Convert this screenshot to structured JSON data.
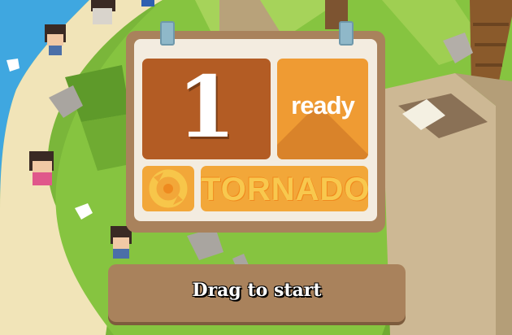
{
  "title_card": {
    "count": "1",
    "status": "ready",
    "power_up": "TORNADO",
    "power_up_icon": "tornado-icon"
  },
  "start_button": {
    "label": "Drag to start"
  },
  "colors": {
    "card_border": "#a9825c",
    "count_tile": "#b35c24",
    "ready_tile": "#ef9b33",
    "power_tile": "#f2a739",
    "button": "#a9825c"
  }
}
